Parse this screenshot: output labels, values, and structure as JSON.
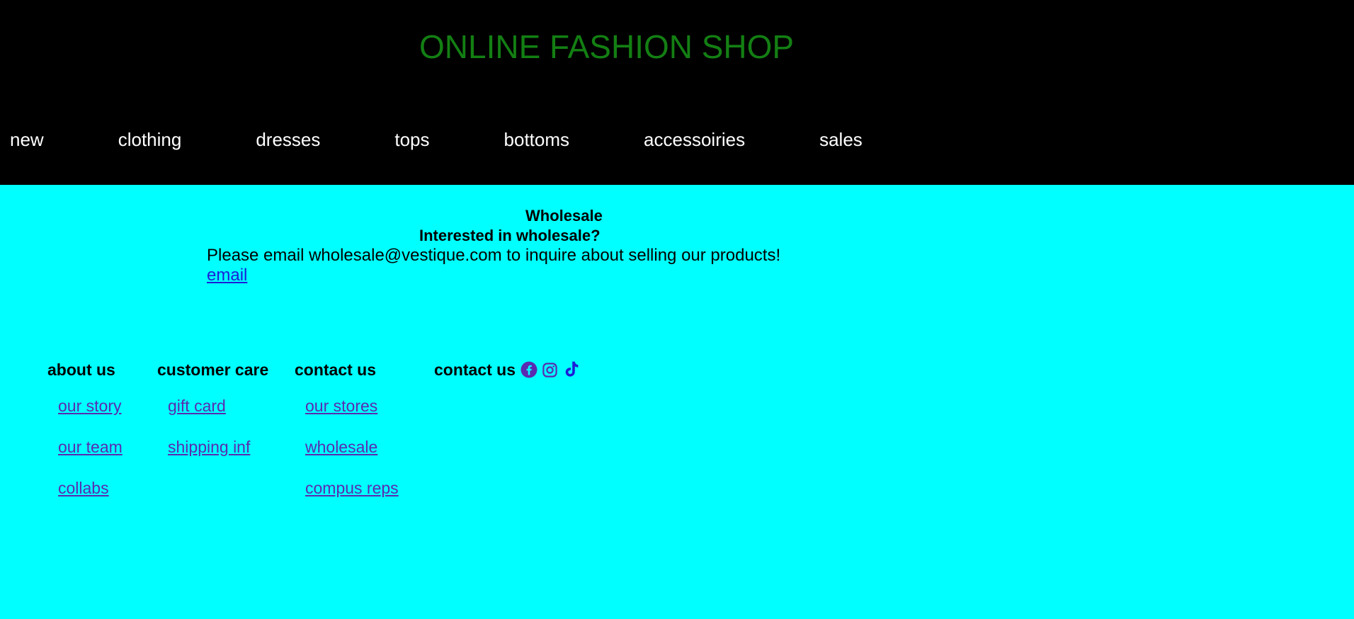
{
  "header": {
    "title": "ONLINE FASHION SHOP",
    "title_color": "#137f13",
    "background": "#000000"
  },
  "nav": {
    "items": [
      {
        "label": "new"
      },
      {
        "label": "clothing"
      },
      {
        "label": "dresses"
      },
      {
        "label": "tops"
      },
      {
        "label": "bottoms"
      },
      {
        "label": "accessoiries"
      },
      {
        "label": "sales"
      }
    ]
  },
  "wholesale": {
    "title": "Wholesale",
    "subtitle": "Interested in wholesale?",
    "text": "Please email wholesale@vestique.com to inquire about selling our products!",
    "link_label": "email"
  },
  "footer": {
    "columns": [
      {
        "heading": "about us",
        "links": [
          "our story",
          "our team",
          "collabs"
        ]
      },
      {
        "heading": "customer care",
        "links": [
          "gift card",
          "shipping inf"
        ]
      },
      {
        "heading": "contact us",
        "links": [
          "our stores",
          "wholesale",
          "compus reps"
        ]
      }
    ],
    "social": {
      "heading": "contact us",
      "icons": [
        "facebook-icon",
        "instagram-icon",
        "tiktok-icon"
      ]
    }
  },
  "colors": {
    "page_background": "#00ffff",
    "link": "#5a2bb0",
    "nav_text": "#ffffff"
  }
}
